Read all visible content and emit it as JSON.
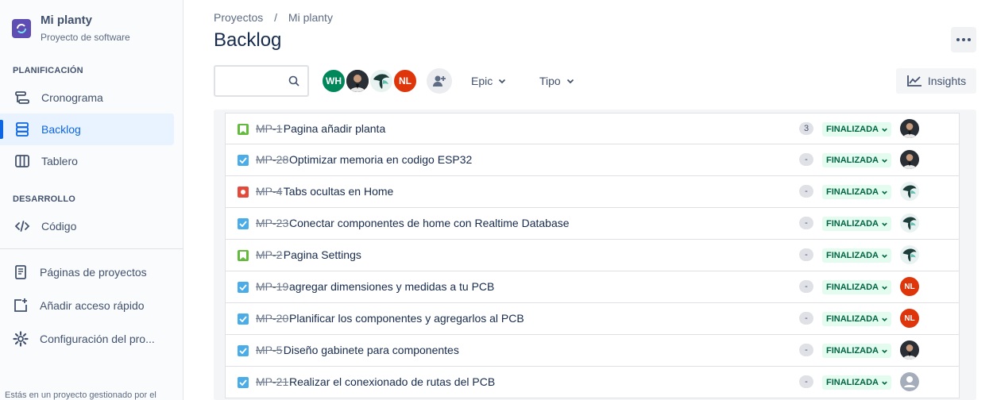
{
  "project": {
    "name": "Mi planty",
    "subtitle": "Proyecto de software"
  },
  "sidebar": {
    "planning_title": "PLANIFICACIÓN",
    "dev_title": "DESARROLLO",
    "items": [
      {
        "label": "Cronograma",
        "icon": "timeline-icon"
      },
      {
        "label": "Backlog",
        "icon": "backlog-icon",
        "active": true
      },
      {
        "label": "Tablero",
        "icon": "board-icon"
      },
      {
        "label": "Código",
        "icon": "code-icon"
      },
      {
        "label": "Páginas de proyectos",
        "icon": "page-icon"
      },
      {
        "label": "Añadir acceso rápido",
        "icon": "add-shortcut-icon"
      },
      {
        "label": "Configuración del pro...",
        "icon": "gear-icon"
      }
    ],
    "footer": "Estás en un proyecto gestionado por el"
  },
  "breadcrumb": {
    "root": "Proyectos",
    "separator": "/",
    "current": "Mi planty"
  },
  "page_title": "Backlog",
  "search": {
    "placeholder": ""
  },
  "avatars": [
    {
      "initials": "WH",
      "color": "#00875A"
    },
    {
      "initials": "",
      "kind": "photo"
    },
    {
      "initials": "",
      "kind": "bird"
    },
    {
      "initials": "NL",
      "color": "#DE350B"
    }
  ],
  "filters": {
    "epic": "Epic",
    "type": "Tipo"
  },
  "insights_label": "Insights",
  "issues": [
    {
      "type": "story",
      "key": "MP-1",
      "summary": "Pagina añadir planta",
      "points": "3",
      "status": "FINALIZADA",
      "assignee": "photo"
    },
    {
      "type": "task",
      "key": "MP-28",
      "summary": "Optimizar memoria en codigo ESP32",
      "points": "-",
      "status": "FINALIZADA",
      "assignee": "photo"
    },
    {
      "type": "bug",
      "key": "MP-4",
      "summary": "Tabs ocultas en Home",
      "points": "-",
      "status": "FINALIZADA",
      "assignee": "bird"
    },
    {
      "type": "task",
      "key": "MP-23",
      "summary": "Conectar componentes de home con Realtime Database",
      "points": "-",
      "status": "FINALIZADA",
      "assignee": "bird"
    },
    {
      "type": "story",
      "key": "MP-2",
      "summary": "Pagina Settings",
      "points": "-",
      "status": "FINALIZADA",
      "assignee": "bird"
    },
    {
      "type": "task",
      "key": "MP-19",
      "summary": "agregar dimensiones y medidas a tu PCB",
      "points": "-",
      "status": "FINALIZADA",
      "assignee": "NL"
    },
    {
      "type": "task",
      "key": "MP-20",
      "summary": "Planificar los componentes y agregarlos al PCB",
      "points": "-",
      "status": "FINALIZADA",
      "assignee": "NL"
    },
    {
      "type": "task",
      "key": "MP-5",
      "summary": "Diseño gabinete para componentes",
      "points": "-",
      "status": "FINALIZADA",
      "assignee": "photo"
    },
    {
      "type": "task",
      "key": "MP-21",
      "summary": "Realizar el conexionado de rutas del PCB",
      "points": "-",
      "status": "FINALIZADA",
      "assignee": "unassigned"
    }
  ],
  "colors": {
    "accent": "#0C66E4",
    "status_bg": "#E3FCEF",
    "status_text": "#006644",
    "story": "#63BA3C",
    "task": "#4BADE8",
    "bug": "#E5493A"
  }
}
